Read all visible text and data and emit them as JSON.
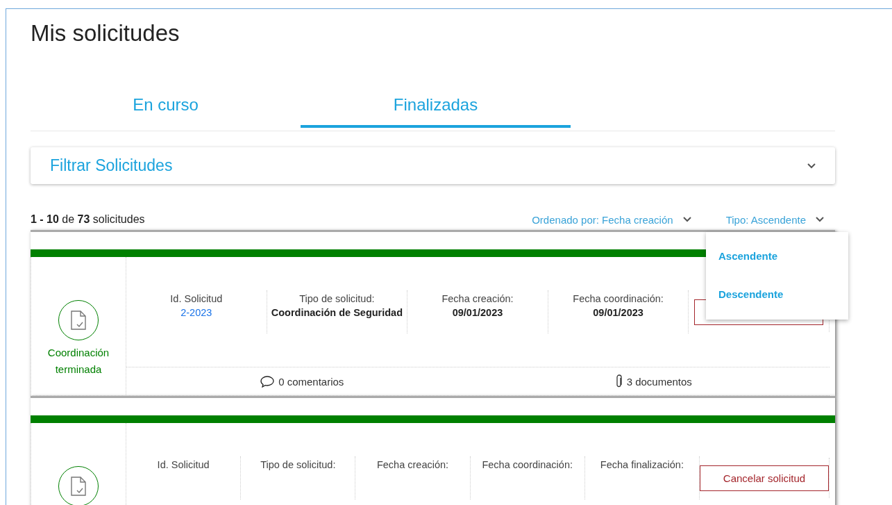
{
  "title": "Mis solicitudes",
  "tabs": [
    {
      "label": "En curso",
      "selected": false
    },
    {
      "label": "Finalizadas",
      "selected": true
    }
  ],
  "filter": {
    "title": "Filtrar Solicitudes",
    "expanded": false
  },
  "summary": "**1 - 10** de **73** solicitudes",
  "sort": {
    "label": "Ordenado por: Fecha creación"
  },
  "order": {
    "label": "Tipo: Ascendente",
    "options": [
      {
        "label": "Ascendente"
      },
      {
        "label": "Descendente"
      }
    ]
  },
  "cards": [
    {
      "status": "Coordinación terminada",
      "color": "#008000",
      "fields": [
        {
          "label": "Id. Solicitud",
          "value": "2-2023",
          "kind": "link"
        },
        {
          "label": "Tipo de solicitud:",
          "value": "Coordinación de Seguridad",
          "kind": "text"
        },
        {
          "label": "Fecha creación:",
          "value": "09/01/2023",
          "kind": "text"
        },
        {
          "label": "Fecha coordinación:",
          "value": "09/01/2023",
          "kind": "text"
        }
      ],
      "covered_button": true,
      "comments": "0 comentarios",
      "documents": "3 documentos"
    },
    {
      "color": "#008000",
      "fields": [
        {
          "label": "Id. Solicitud"
        },
        {
          "label": "Tipo de solicitud:"
        },
        {
          "label": "Fecha creación:"
        },
        {
          "label": "Fecha coordinación:"
        },
        {
          "label": "Fecha finalización:"
        }
      ],
      "action": {
        "label": "Cancelar solicitud"
      }
    }
  ]
}
